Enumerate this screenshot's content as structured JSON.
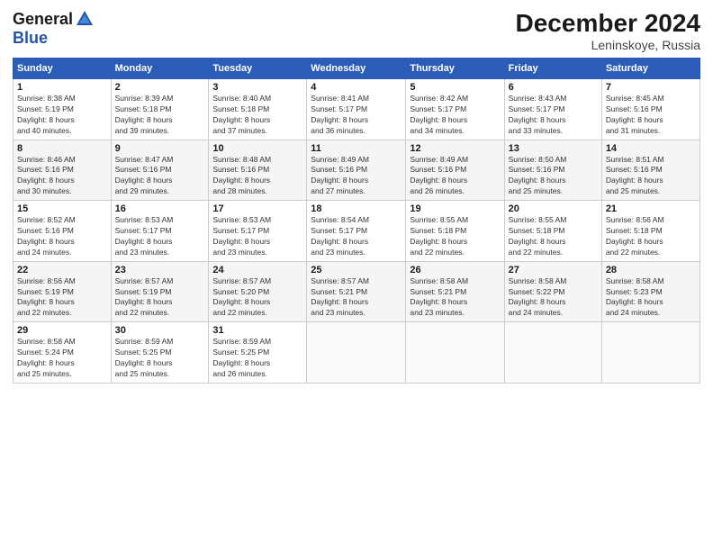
{
  "header": {
    "logo_general": "General",
    "logo_blue": "Blue",
    "title": "December 2024",
    "location": "Leninskoye, Russia"
  },
  "days_of_week": [
    "Sunday",
    "Monday",
    "Tuesday",
    "Wednesday",
    "Thursday",
    "Friday",
    "Saturday"
  ],
  "weeks": [
    [
      {
        "day": "1",
        "info": "Sunrise: 8:38 AM\nSunset: 5:19 PM\nDaylight: 8 hours\nand 40 minutes."
      },
      {
        "day": "2",
        "info": "Sunrise: 8:39 AM\nSunset: 5:18 PM\nDaylight: 8 hours\nand 39 minutes."
      },
      {
        "day": "3",
        "info": "Sunrise: 8:40 AM\nSunset: 5:18 PM\nDaylight: 8 hours\nand 37 minutes."
      },
      {
        "day": "4",
        "info": "Sunrise: 8:41 AM\nSunset: 5:17 PM\nDaylight: 8 hours\nand 36 minutes."
      },
      {
        "day": "5",
        "info": "Sunrise: 8:42 AM\nSunset: 5:17 PM\nDaylight: 8 hours\nand 34 minutes."
      },
      {
        "day": "6",
        "info": "Sunrise: 8:43 AM\nSunset: 5:17 PM\nDaylight: 8 hours\nand 33 minutes."
      },
      {
        "day": "7",
        "info": "Sunrise: 8:45 AM\nSunset: 5:16 PM\nDaylight: 8 hours\nand 31 minutes."
      }
    ],
    [
      {
        "day": "8",
        "info": "Sunrise: 8:46 AM\nSunset: 5:16 PM\nDaylight: 8 hours\nand 30 minutes."
      },
      {
        "day": "9",
        "info": "Sunrise: 8:47 AM\nSunset: 5:16 PM\nDaylight: 8 hours\nand 29 minutes."
      },
      {
        "day": "10",
        "info": "Sunrise: 8:48 AM\nSunset: 5:16 PM\nDaylight: 8 hours\nand 28 minutes."
      },
      {
        "day": "11",
        "info": "Sunrise: 8:49 AM\nSunset: 5:16 PM\nDaylight: 8 hours\nand 27 minutes."
      },
      {
        "day": "12",
        "info": "Sunrise: 8:49 AM\nSunset: 5:16 PM\nDaylight: 8 hours\nand 26 minutes."
      },
      {
        "day": "13",
        "info": "Sunrise: 8:50 AM\nSunset: 5:16 PM\nDaylight: 8 hours\nand 25 minutes."
      },
      {
        "day": "14",
        "info": "Sunrise: 8:51 AM\nSunset: 5:16 PM\nDaylight: 8 hours\nand 25 minutes."
      }
    ],
    [
      {
        "day": "15",
        "info": "Sunrise: 8:52 AM\nSunset: 5:16 PM\nDaylight: 8 hours\nand 24 minutes."
      },
      {
        "day": "16",
        "info": "Sunrise: 8:53 AM\nSunset: 5:17 PM\nDaylight: 8 hours\nand 23 minutes."
      },
      {
        "day": "17",
        "info": "Sunrise: 8:53 AM\nSunset: 5:17 PM\nDaylight: 8 hours\nand 23 minutes."
      },
      {
        "day": "18",
        "info": "Sunrise: 8:54 AM\nSunset: 5:17 PM\nDaylight: 8 hours\nand 23 minutes."
      },
      {
        "day": "19",
        "info": "Sunrise: 8:55 AM\nSunset: 5:18 PM\nDaylight: 8 hours\nand 22 minutes."
      },
      {
        "day": "20",
        "info": "Sunrise: 8:55 AM\nSunset: 5:18 PM\nDaylight: 8 hours\nand 22 minutes."
      },
      {
        "day": "21",
        "info": "Sunrise: 8:56 AM\nSunset: 5:18 PM\nDaylight: 8 hours\nand 22 minutes."
      }
    ],
    [
      {
        "day": "22",
        "info": "Sunrise: 8:56 AM\nSunset: 5:19 PM\nDaylight: 8 hours\nand 22 minutes."
      },
      {
        "day": "23",
        "info": "Sunrise: 8:57 AM\nSunset: 5:19 PM\nDaylight: 8 hours\nand 22 minutes."
      },
      {
        "day": "24",
        "info": "Sunrise: 8:57 AM\nSunset: 5:20 PM\nDaylight: 8 hours\nand 22 minutes."
      },
      {
        "day": "25",
        "info": "Sunrise: 8:57 AM\nSunset: 5:21 PM\nDaylight: 8 hours\nand 23 minutes."
      },
      {
        "day": "26",
        "info": "Sunrise: 8:58 AM\nSunset: 5:21 PM\nDaylight: 8 hours\nand 23 minutes."
      },
      {
        "day": "27",
        "info": "Sunrise: 8:58 AM\nSunset: 5:22 PM\nDaylight: 8 hours\nand 24 minutes."
      },
      {
        "day": "28",
        "info": "Sunrise: 8:58 AM\nSunset: 5:23 PM\nDaylight: 8 hours\nand 24 minutes."
      }
    ],
    [
      {
        "day": "29",
        "info": "Sunrise: 8:58 AM\nSunset: 5:24 PM\nDaylight: 8 hours\nand 25 minutes."
      },
      {
        "day": "30",
        "info": "Sunrise: 8:59 AM\nSunset: 5:25 PM\nDaylight: 8 hours\nand 25 minutes."
      },
      {
        "day": "31",
        "info": "Sunrise: 8:59 AM\nSunset: 5:25 PM\nDaylight: 8 hours\nand 26 minutes."
      },
      {
        "day": "",
        "info": ""
      },
      {
        "day": "",
        "info": ""
      },
      {
        "day": "",
        "info": ""
      },
      {
        "day": "",
        "info": ""
      }
    ]
  ]
}
